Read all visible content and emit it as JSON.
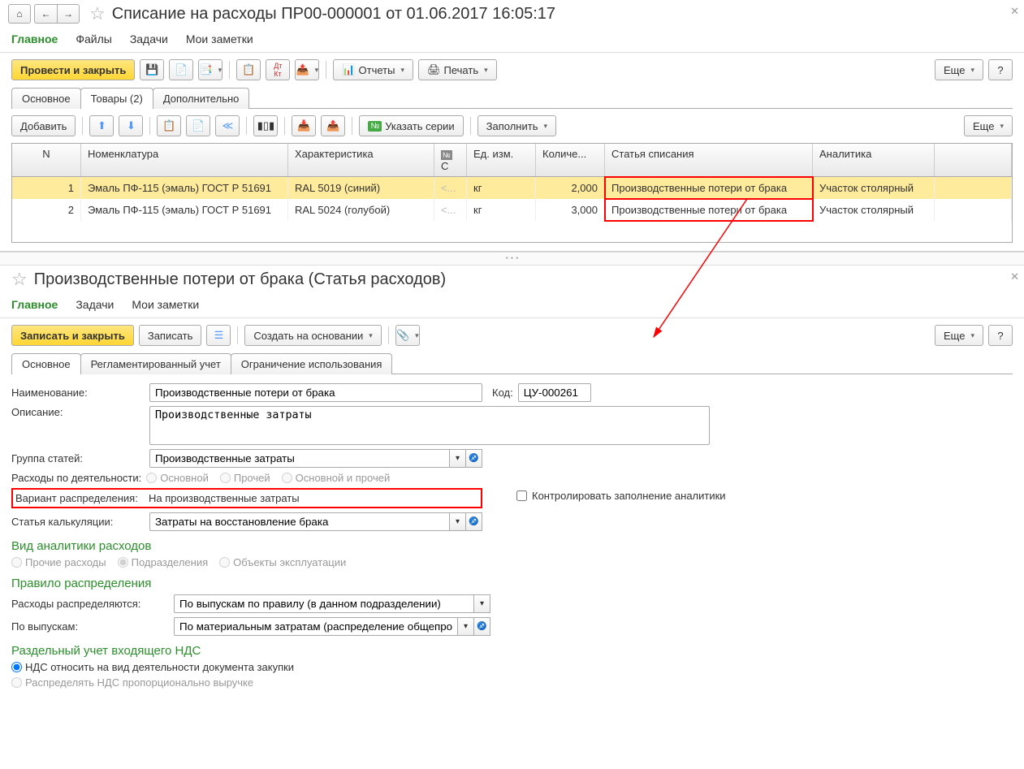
{
  "top": {
    "title": "Списание на расходы ПР00-000001 от 01.06.2017 16:05:17",
    "tabs": [
      "Главное",
      "Файлы",
      "Задачи",
      "Мои заметки"
    ],
    "toolbar": {
      "post_close": "Провести и закрыть",
      "reports": "Отчеты",
      "print": "Печать",
      "more": "Еще"
    },
    "sub_tabs": [
      "Основное",
      "Товары (2)",
      "Дополнительно"
    ],
    "grid_toolbar": {
      "add": "Добавить",
      "series": "Указать серии",
      "fill": "Заполнить",
      "more": "Еще"
    },
    "grid": {
      "headers": [
        "N",
        "Номенклатура",
        "Характеристика",
        "С",
        "Ед. изм.",
        "Количе...",
        "Статья списания",
        "Аналитика"
      ],
      "rows": [
        {
          "n": "1",
          "nom": "Эмаль ПФ-115 (эмаль) ГОСТ Р 51691",
          "char": "RAL 5019 (синий)",
          "s": "<...",
          "unit": "кг",
          "qty": "2,000",
          "art": "Производственные потери от брака",
          "anal": "Участок столярный"
        },
        {
          "n": "2",
          "nom": "Эмаль ПФ-115 (эмаль) ГОСТ Р 51691",
          "char": "RAL 5024 (голубой)",
          "s": "<...",
          "unit": "кг",
          "qty": "3,000",
          "art": "Производственные потери от брака",
          "anal": "Участок столярный"
        }
      ]
    }
  },
  "bottom": {
    "title": "Производственные потери от брака (Статья расходов)",
    "tabs": [
      "Главное",
      "Задачи",
      "Мои заметки"
    ],
    "toolbar": {
      "save_close": "Записать и закрыть",
      "save": "Записать",
      "create_based": "Создать на основании",
      "more": "Еще"
    },
    "sub_tabs": [
      "Основное",
      "Регламентированный учет",
      "Ограничение использования"
    ],
    "form": {
      "name_lbl": "Наименование:",
      "name_val": "Производственные потери от брака",
      "code_lbl": "Код:",
      "code_val": "ЦУ-000261",
      "desc_lbl": "Описание:",
      "desc_val": "Производственные затраты",
      "group_lbl": "Группа статей:",
      "group_val": "Производственные затраты",
      "act_lbl": "Расходы по деятельности:",
      "act_opts": [
        "Основной",
        "Прочей",
        "Основной и прочей"
      ],
      "dist_lbl": "Вариант распределения:",
      "dist_val": "На производственные затраты",
      "control_lbl": "Контролировать заполнение аналитики",
      "calc_lbl": "Статья калькуляции:",
      "calc_val": "Затраты на восстановление брака",
      "anal_title": "Вид аналитики расходов",
      "anal_opts": [
        "Прочие расходы",
        "Подразделения",
        "Объекты эксплуатации"
      ],
      "rule_title": "Правило распределения",
      "rule_lbl": "Расходы распределяются:",
      "rule_val": "По выпускам по правилу (в данном подразделении)",
      "by_lbl": "По выпускам:",
      "by_val": "По материальным затратам (распределение общепроизводс",
      "vat_title": "Раздельный учет входящего НДС",
      "vat_opts": [
        "НДС относить на вид деятельности документа закупки",
        "Распределять НДС пропорционально выручке"
      ]
    }
  }
}
